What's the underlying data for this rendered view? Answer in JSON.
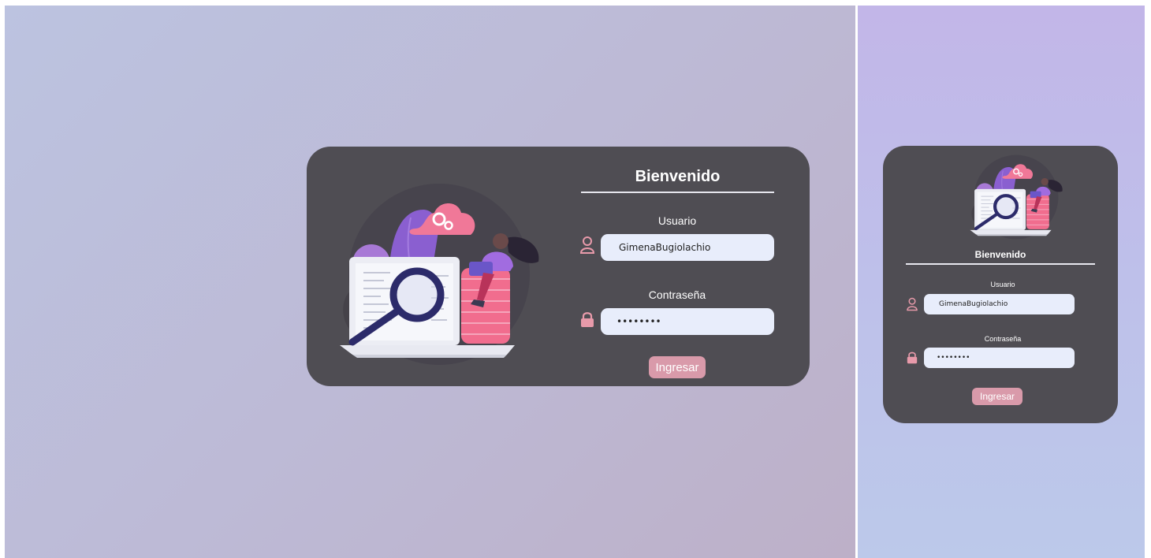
{
  "login": {
    "title": "Bienvenido",
    "username_label": "Usuario",
    "username_value": "GimenaBugiolachio",
    "password_label": "Contraseña",
    "password_value": "passwd12",
    "submit_label": "Ingresar"
  },
  "icons": {
    "user": "user-outline-icon",
    "lock": "lock-icon"
  },
  "colors": {
    "card_background": "#4f4d53",
    "accent_pink": "#d99aaa",
    "input_background": "#e8edfb"
  }
}
